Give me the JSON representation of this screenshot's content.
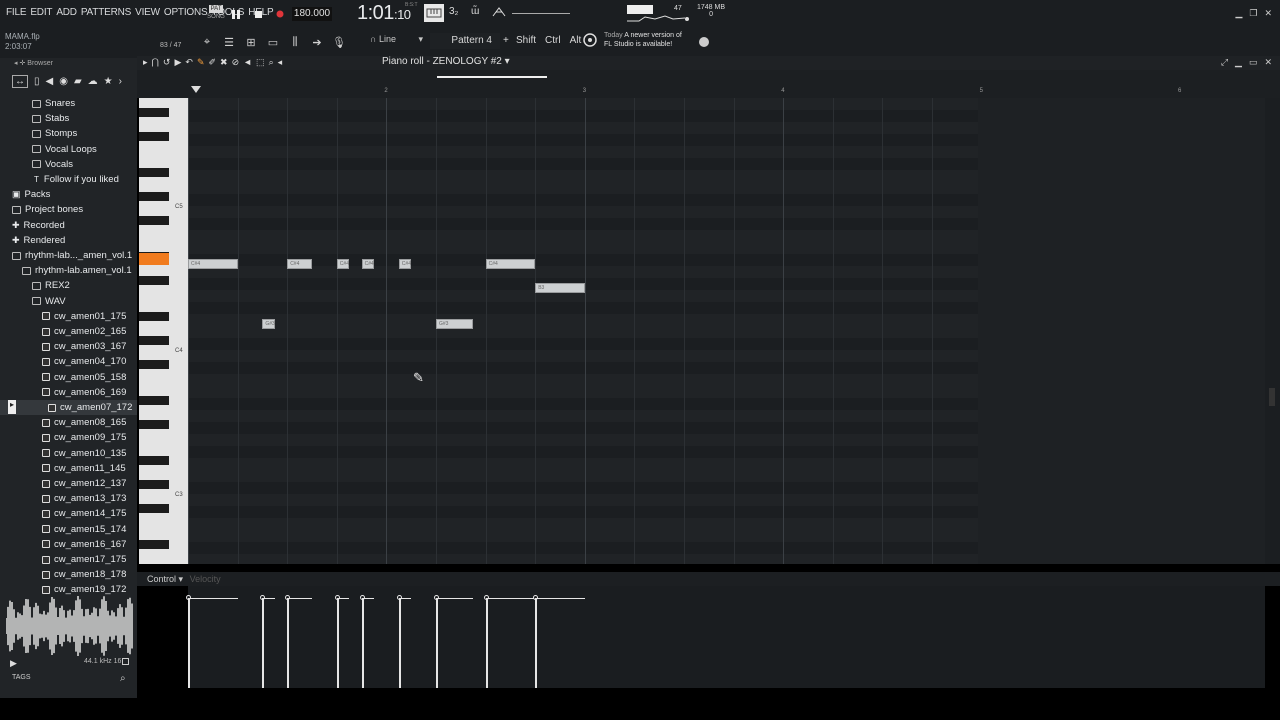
{
  "menu": [
    "FILE",
    "EDIT",
    "ADD",
    "PATTERNS",
    "VIEW",
    "OPTIONS",
    "TOOLS",
    "HELP"
  ],
  "project": {
    "file_name": "MAMA.flp",
    "elapsed": "2:03:07",
    "step_info": "83 / 47"
  },
  "transport": {
    "pat_label": "PAT",
    "song_label": "SONG",
    "tempo": "180.000",
    "time_main": "1:01",
    "time_sub": "10",
    "time_unit": "B:S:T"
  },
  "toolbar": {
    "snap": "Line",
    "pattern": "Pattern 4",
    "mod_shift": "Shift",
    "mod_ctrl": "Ctrl",
    "mod_alt": "Alt",
    "meter_value": "47"
  },
  "news": {
    "line1_prefix": "Today",
    "line1": "A newer version of",
    "line2": "FL Studio is available!"
  },
  "memory": {
    "value": "1748 MB",
    "voices": "0"
  },
  "browser": {
    "title": "Browser",
    "items": [
      {
        "label": "Snares",
        "indent": 32,
        "type": "folder"
      },
      {
        "label": "Stabs",
        "indent": 32,
        "type": "folder"
      },
      {
        "label": "Stomps",
        "indent": 32,
        "type": "folder"
      },
      {
        "label": "Vocal Loops",
        "indent": 32,
        "type": "folder"
      },
      {
        "label": "Vocals",
        "indent": 32,
        "type": "folder"
      },
      {
        "label": "Follow if you liked",
        "indent": 34,
        "type": "text"
      },
      {
        "label": "Packs",
        "indent": 12,
        "type": "pack"
      },
      {
        "label": "Project bones",
        "indent": 12,
        "type": "folder"
      },
      {
        "label": "Recorded",
        "indent": 12,
        "type": "plus"
      },
      {
        "label": "Rendered",
        "indent": 12,
        "type": "plus"
      },
      {
        "label": "rhythm-lab..._amen_vol.1",
        "indent": 12,
        "type": "folder"
      },
      {
        "label": "rhythm-lab.amen_vol.1",
        "indent": 22,
        "type": "folder"
      },
      {
        "label": "REX2",
        "indent": 32,
        "type": "folder"
      },
      {
        "label": "WAV",
        "indent": 32,
        "type": "folder"
      },
      {
        "label": "cw_amen01_175",
        "indent": 42,
        "type": "file"
      },
      {
        "label": "cw_amen02_165",
        "indent": 42,
        "type": "file"
      },
      {
        "label": "cw_amen03_167",
        "indent": 42,
        "type": "file"
      },
      {
        "label": "cw_amen04_170",
        "indent": 42,
        "type": "file"
      },
      {
        "label": "cw_amen05_158",
        "indent": 42,
        "type": "file"
      },
      {
        "label": "cw_amen06_169",
        "indent": 42,
        "type": "file"
      },
      {
        "label": "cw_amen07_172",
        "indent": 48,
        "type": "file",
        "selected": true
      },
      {
        "label": "cw_amen08_165",
        "indent": 42,
        "type": "file"
      },
      {
        "label": "cw_amen09_175",
        "indent": 42,
        "type": "file"
      },
      {
        "label": "cw_amen10_135",
        "indent": 42,
        "type": "file"
      },
      {
        "label": "cw_amen11_145",
        "indent": 42,
        "type": "file"
      },
      {
        "label": "cw_amen12_137",
        "indent": 42,
        "type": "file"
      },
      {
        "label": "cw_amen13_173",
        "indent": 42,
        "type": "file"
      },
      {
        "label": "cw_amen14_175",
        "indent": 42,
        "type": "file"
      },
      {
        "label": "cw_amen15_174",
        "indent": 42,
        "type": "file"
      },
      {
        "label": "cw_amen16_167",
        "indent": 42,
        "type": "file"
      },
      {
        "label": "cw_amen17_175",
        "indent": 42,
        "type": "file"
      },
      {
        "label": "cw_amen18_178",
        "indent": 42,
        "type": "file"
      },
      {
        "label": "cw_amen19_172",
        "indent": 42,
        "type": "file"
      },
      {
        "label": "cw_amen20_164",
        "indent": 42,
        "type": "file"
      },
      {
        "label": "Sliced audio",
        "indent": 12,
        "type": "plus"
      }
    ],
    "sample_info": "44.1 kHz 16",
    "tags_label": "TAGS"
  },
  "piano_roll": {
    "title": "Piano roll - ZENOLOGY #2",
    "bars": [
      "2",
      "3",
      "4",
      "5",
      "6"
    ],
    "key_labels": [
      "C5",
      "C4",
      "C3"
    ],
    "notes": [
      {
        "label": "C#4",
        "start": 1.0,
        "length": 0.25,
        "pitch": "C#4"
      },
      {
        "label": "C#4",
        "start": 1.5,
        "length": 0.125,
        "pitch": "C#4"
      },
      {
        "label": "C#4",
        "start": 1.75,
        "length": 0.0625,
        "pitch": "C#4"
      },
      {
        "label": "C#4",
        "start": 1.875,
        "length": 0.0625,
        "pitch": "C#4"
      },
      {
        "label": "C#4",
        "start": 2.0625,
        "length": 0.0625,
        "pitch": "C#4"
      },
      {
        "label": "C#4",
        "start": 2.5,
        "length": 0.25,
        "pitch": "C#4"
      },
      {
        "label": "B3",
        "start": 2.75,
        "length": 0.25,
        "pitch": "B3"
      },
      {
        "label": "G#3",
        "start": 1.375,
        "length": 0.0625,
        "pitch": "G#3"
      },
      {
        "label": "G#3",
        "start": 2.25,
        "length": 0.1875,
        "pitch": "G#3"
      }
    ],
    "control_label": "Control",
    "control_target": "Velocity",
    "velocities": [
      1.0,
      1.0,
      1.0,
      1.0,
      1.0,
      1.0,
      1.0,
      1.0,
      1.0
    ]
  }
}
